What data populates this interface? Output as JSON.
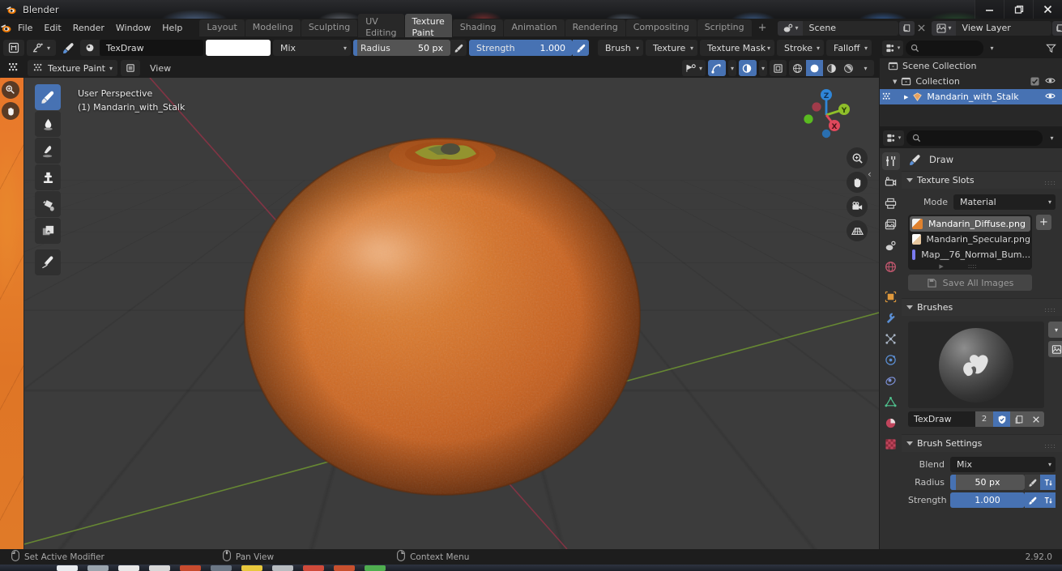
{
  "window": {
    "title": "Blender",
    "controls": {
      "minimize": "—",
      "maximize": "❐",
      "close": "✕"
    }
  },
  "topbar": {
    "menus": [
      "File",
      "Edit",
      "Render",
      "Window",
      "Help"
    ],
    "workspaces": [
      "Layout",
      "Modeling",
      "Sculpting",
      "UV Editing",
      "Texture Paint",
      "Shading",
      "Animation",
      "Rendering",
      "Compositing",
      "Scripting"
    ],
    "active_workspace": "Texture Paint",
    "add_workspace": "+",
    "scene": {
      "label": "Scene",
      "new_icon": "new-scene-icon",
      "remove_icon": "x-icon"
    },
    "view_layer": {
      "label": "View Layer",
      "new_icon": "new-viewlayer-icon",
      "remove_icon": "x-icon"
    }
  },
  "tool_header": {
    "editor_type_icon": "editor-type-icon",
    "brush_preset_icon": "brush-preset-icon",
    "brush_icon": "brush-icon",
    "brush_name": "TexDraw",
    "color": "#ffffff",
    "blend": "Mix",
    "radius": {
      "label": "Radius",
      "value": "50 px",
      "fill_pct": 4
    },
    "strength": {
      "label": "Strength",
      "value": "1.000",
      "fill_pct": 100
    },
    "menus": [
      "Brush",
      "Texture",
      "Texture Mask",
      "Stroke",
      "Falloff"
    ]
  },
  "viewport_header": {
    "mode": "Texture Paint",
    "view_menu": "View",
    "canvas_icon": "canvas-icon",
    "toggles": [
      {
        "name": "visibility-icon",
        "on": false
      },
      {
        "name": "gizmo-icon",
        "on": true
      },
      {
        "name": "overlays-icon",
        "on": true
      },
      {
        "name": "xray-icon",
        "on": false
      }
    ],
    "shading_modes": [
      "wireframe",
      "solid",
      "material-preview",
      "rendered"
    ],
    "active_shading": "solid"
  },
  "viewport": {
    "overlay_line1": "User Perspective",
    "overlay_line2": "(1) Mandarin_with_Stalk",
    "background": "#3c3c3c",
    "tools": [
      {
        "name": "draw-tool",
        "active": true
      },
      {
        "name": "soften-tool",
        "active": false
      },
      {
        "name": "smear-tool",
        "active": false
      },
      {
        "name": "clone-tool",
        "active": false
      },
      {
        "name": "fill-tool",
        "active": false
      },
      {
        "name": "mask-tool",
        "active": false
      },
      {
        "name": "annotate-tool",
        "active": false
      }
    ],
    "gizmo_axes": [
      {
        "label": "Z",
        "color": "#2f86d8"
      },
      {
        "label": "Y",
        "color": "#8fbf2a"
      },
      {
        "label": "X",
        "color": "#e0485c"
      }
    ],
    "nav_buttons": [
      "zoom-icon",
      "pan-hand-icon",
      "camera-icon",
      "grid-ortho-icon"
    ],
    "left_strip_buttons": [
      "cursor-icon",
      "hand-icon"
    ],
    "object_name": "Mandarin_with_Stalk"
  },
  "outliner": {
    "display_mode_icon": "outliner-display-icon",
    "search_placeholder": "",
    "filter_icon": "filter-icon",
    "rows": [
      {
        "label": "Scene Collection",
        "icon": "collection-icon",
        "indent": 0,
        "selected": false,
        "has_check": false,
        "has_eye": false,
        "expander": ""
      },
      {
        "label": "Collection",
        "icon": "collection-icon",
        "indent": 1,
        "selected": false,
        "has_check": true,
        "has_eye": true,
        "expander": "▼"
      },
      {
        "label": "Mandarin_with_Stalk",
        "icon": "mesh-icon",
        "indent": 2,
        "selected": true,
        "has_check": false,
        "has_eye": true,
        "expander": "▶"
      }
    ]
  },
  "properties": {
    "search_placeholder": "",
    "editor_icon": "properties-editor-icon",
    "browse_icon": "browse-icon",
    "tabs": [
      {
        "name": "tool",
        "active": true,
        "color": "#d8d8d8"
      },
      {
        "name": "render",
        "active": false,
        "color": "#d8d8d8"
      },
      {
        "name": "output",
        "active": false,
        "color": "#d8d8d8"
      },
      {
        "name": "view-layer",
        "active": false,
        "color": "#d8d8d8"
      },
      {
        "name": "scene",
        "active": false,
        "color": "#d8d8d8"
      },
      {
        "name": "world",
        "active": false,
        "color": "#c2576e"
      },
      {
        "name": "object",
        "active": false,
        "color": "#e0993c"
      },
      {
        "name": "modifiers",
        "active": false,
        "color": "#5b8fd4"
      },
      {
        "name": "particles",
        "active": false,
        "color": "#a8b4c4"
      },
      {
        "name": "physics",
        "active": false,
        "color": "#5b8fd4"
      },
      {
        "name": "constraints",
        "active": false,
        "color": "#7b8fd4"
      },
      {
        "name": "data",
        "active": false,
        "color": "#4fc08d"
      },
      {
        "name": "material",
        "active": false,
        "color": "#d45a6e"
      },
      {
        "name": "texture",
        "active": false,
        "color": "#d45a6e"
      }
    ],
    "tool_title": "Draw",
    "panels": {
      "texture_slots": {
        "title": "Texture Slots",
        "mode_label": "Mode",
        "mode_value": "Material",
        "slots": [
          {
            "name": "Mandarin_Diffuse.png",
            "swatch": "#e0822e",
            "selected": true
          },
          {
            "name": "Mandarin_Specular.png",
            "swatch": "#eddcc9",
            "selected": false
          },
          {
            "name": "Map__76_Normal_Bum...",
            "swatch": "#7b7bf0",
            "selected": false
          }
        ],
        "add_button": "+",
        "save_all_label": "Save All Images"
      },
      "brushes": {
        "title": "Brushes",
        "brush_name": "TexDraw",
        "users_count": "2",
        "fake_user_on": true,
        "copy_icon": "duplicate-icon",
        "delete_icon": "x-icon",
        "expand_icon": "chevron-down-icon",
        "preview_icon": "image-icon"
      },
      "brush_settings": {
        "title": "Brush Settings",
        "blend_label": "Blend",
        "blend_value": "Mix",
        "radius_label": "Radius",
        "radius_value": "50 px",
        "radius_fill_pct": 8,
        "strength_label": "Strength",
        "strength_value": "1.000",
        "strength_fill_pct": 100
      }
    }
  },
  "statusbar": {
    "items": [
      {
        "icon": "mouse-left-icon",
        "label": "Set Active Modifier"
      },
      {
        "icon": "mouse-middle-icon",
        "label": "Pan View"
      },
      {
        "icon": "mouse-right-icon",
        "label": "Context Menu"
      }
    ],
    "version": "2.92.0"
  },
  "colors": {
    "accent_blue": "#4772b3",
    "header_bg": "#1d1d1d",
    "panel_bg": "#303030",
    "viewport_bg": "#3c3c3c",
    "orange": "#e0822e"
  }
}
